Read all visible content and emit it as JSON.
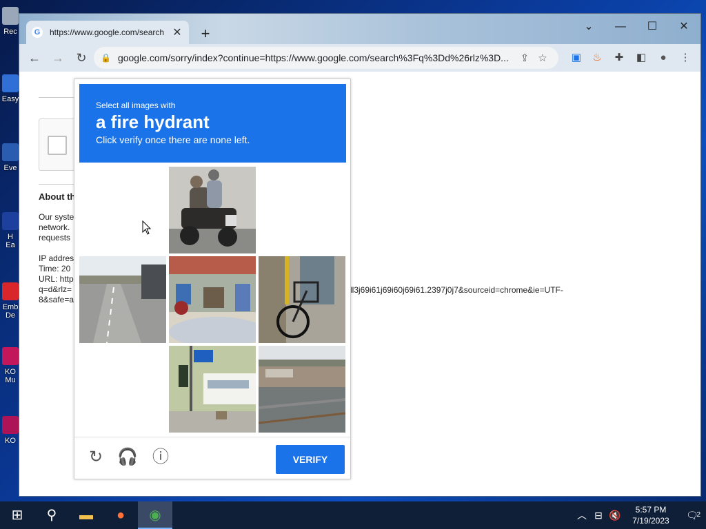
{
  "desktop": {
    "icons": [
      {
        "label": "Rec"
      },
      {
        "label": "Easy"
      },
      {
        "label": "Eve"
      },
      {
        "label": "H\nEa"
      },
      {
        "label": "Emb\nDe"
      },
      {
        "label": "KO\nMu"
      },
      {
        "label": "KO"
      }
    ]
  },
  "browser": {
    "tab_title": "https://www.google.com/search",
    "favicon": "G",
    "url": "google.com/sorry/index?continue=https://www.google.com/search%3Fq%3Dd%26rlz%3D...",
    "window_controls": {
      "chevron": "⌄",
      "minimize": "—",
      "maximize": "☐",
      "close": "✕"
    }
  },
  "page": {
    "about_heading": "About th",
    "body_lines": [
      "Our syste",
      "network.",
      "requests"
    ],
    "ip_lines": [
      "IP addres",
      "Time: 20",
      "URL: http",
      "q=d&rlz=",
      "8&safe=a"
    ],
    "url_tail_1": "ll3j69i61j69i60j69i61.2397j0j7&sourceid=chrome&ie=UTF-",
    "url_tail_2": ""
  },
  "captcha": {
    "prompt_line1": "Select all images with",
    "prompt_target": "a fire hydrant",
    "prompt_line3": "Click verify once there are none left.",
    "verify_label": "VERIFY",
    "tiles": [
      {
        "kind": "empty"
      },
      {
        "kind": "motorcycle-riders"
      },
      {
        "kind": "empty"
      },
      {
        "kind": "road"
      },
      {
        "kind": "street-market"
      },
      {
        "kind": "bicycle"
      },
      {
        "kind": "empty"
      },
      {
        "kind": "bus-stop-signs"
      },
      {
        "kind": "highway-overpass"
      }
    ],
    "colors": {
      "accent": "#1a73e8"
    }
  },
  "taskbar": {
    "time": "5:57 PM",
    "date": "7/19/2023",
    "notification_count": "2"
  }
}
